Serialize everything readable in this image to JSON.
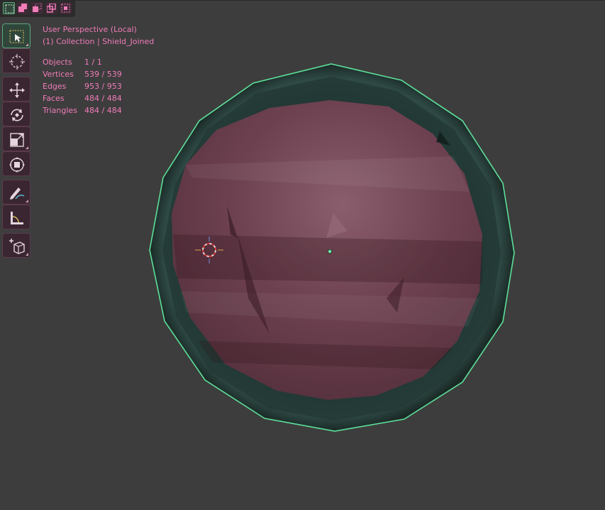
{
  "viewport": {
    "title": "User Perspective (Local)",
    "collection_line": "(1) Collection | Shield_Joined"
  },
  "stats": [
    {
      "label": "Objects",
      "value": "1 / 1"
    },
    {
      "label": "Vertices",
      "value": "539 / 539"
    },
    {
      "label": "Edges",
      "value": "953 / 953"
    },
    {
      "label": "Faces",
      "value": "484 / 484"
    },
    {
      "label": "Triangles",
      "value": "484 / 484"
    }
  ],
  "select_modes": [
    {
      "icon": "select-new-icon",
      "active": true
    },
    {
      "icon": "select-extend-icon",
      "active": false
    },
    {
      "icon": "select-subtract-icon",
      "active": false
    },
    {
      "icon": "select-invert-icon",
      "active": false
    },
    {
      "icon": "select-intersect-icon",
      "active": false
    }
  ],
  "tools": [
    {
      "icon": "select-box-icon",
      "active": true
    },
    {
      "icon": "cursor-icon",
      "active": false
    },
    {
      "icon": "move-icon",
      "active": false
    },
    {
      "icon": "rotate-icon",
      "active": false
    },
    {
      "icon": "scale-icon",
      "active": false
    },
    {
      "icon": "transform-icon",
      "active": false
    },
    {
      "icon": "annotate-icon",
      "active": false
    },
    {
      "icon": "measure-icon",
      "active": false
    },
    {
      "icon": "add-cube-icon",
      "active": false
    }
  ],
  "colors": {
    "background": "#3d3d3d",
    "overlay_text": "#f07cb8",
    "outline": "#5de09a",
    "rim": "#1f3430",
    "face": "#6a3f4c"
  }
}
